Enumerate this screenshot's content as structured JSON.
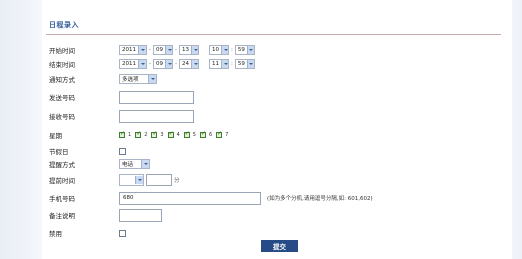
{
  "title": "日程录入",
  "labels": {
    "start_time": "开始时间",
    "end_time": "结束时间",
    "notify_mode": "通知方式",
    "sender_number": "发送号码",
    "receiver_number": "接收号码",
    "weekday": "星期",
    "holiday": "节假日",
    "alarm_mode": "提醒方式",
    "advance_time": "提前时间",
    "phone_number": "手机号码",
    "remarks": "备注说明",
    "disable": "禁用"
  },
  "start": {
    "year": "2011",
    "month": "09",
    "day": "13",
    "hour": "10",
    "minute": "59"
  },
  "end": {
    "year": "2011",
    "month": "09",
    "day": "24",
    "hour": "11",
    "minute": "59"
  },
  "separators": {
    "dash": "-",
    "colon": ":"
  },
  "notify_mode_value": "多选项",
  "alarm_mode_value": "电话",
  "advance_unit": "分",
  "weekdays": [
    "1",
    "2",
    "3",
    "4",
    "5",
    "6",
    "7"
  ],
  "phone_value": "680",
  "phone_note": "(如为多个分机,请用逗号分隔,如: 601,602)",
  "submit_label": "提交"
}
